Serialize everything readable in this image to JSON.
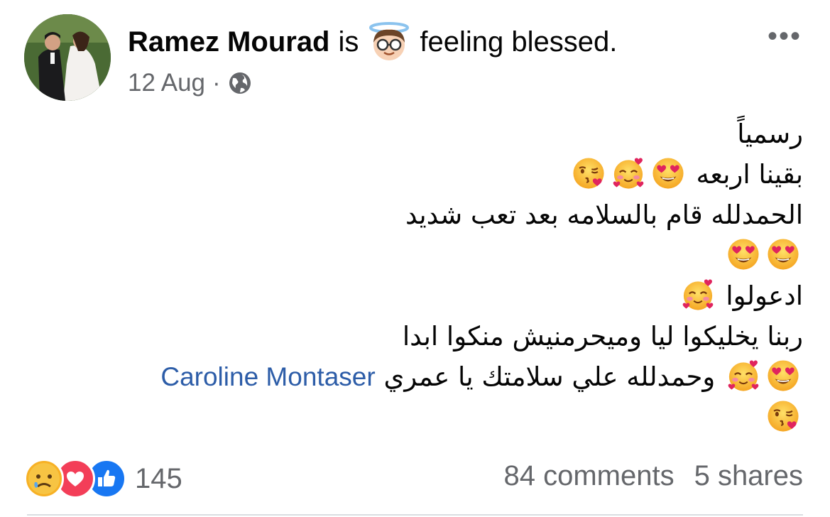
{
  "post": {
    "author": "Ramez Mourad",
    "is_word": "is",
    "feeling_text": "feeling blessed.",
    "feeling_icon": "smiling-face-with-halo-icon",
    "date": "12 Aug",
    "dot": "·",
    "audience_icon": "globe-icon",
    "more_icon": "more-options-icon",
    "more_label": "•••"
  },
  "body": {
    "line1": "رسمياً",
    "line2_text": "بقينا اربعه",
    "line3": "الحمدلله قام بالسلامه بعد تعب شديد",
    "line5_text": "ادعولوا",
    "line6": "ربنا يخليكوا ليا وميحرمنيش منكوا ابدا",
    "line7_text": "وحمدلله علي سلامتك يا عمري",
    "mention": "Caroline Montaser",
    "emoji_names": [
      "heart-eyes-icon",
      "smiling-face-with-hearts-icon",
      "face-blowing-kiss-icon"
    ]
  },
  "footer": {
    "reaction_icons": [
      "sad-reaction-icon",
      "love-reaction-icon",
      "like-reaction-icon"
    ],
    "reaction_count": "145",
    "comments": "84 comments",
    "shares": "5 shares"
  },
  "colors": {
    "text": "#050505",
    "secondary": "#65676b",
    "mention": "#2d5da8",
    "like_blue": "#1877f2",
    "love_red": "#f33e58",
    "sad_yellow": "#f7b125"
  }
}
